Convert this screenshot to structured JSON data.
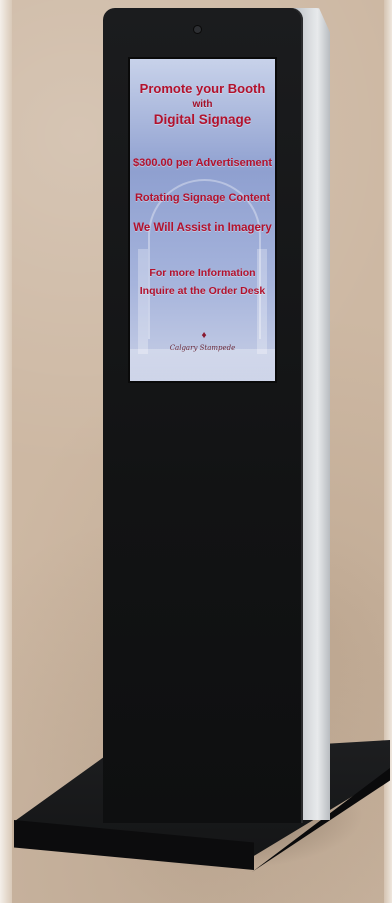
{
  "kiosk": {
    "screen": {
      "headline_line1": "Promote your Booth",
      "headline_line2": "with",
      "headline_line3": "Digital Signage",
      "price_line": "$300.00 per Advertisement",
      "feature_line1": "Rotating Signage Content",
      "feature_line2": "We Will Assist in Imagery",
      "info_line1": "For more Information",
      "info_line2": "Inquire at the Order Desk",
      "logo_text": "Calgary Stampede"
    }
  },
  "colors": {
    "screen_text": "#b3122d",
    "kiosk_body": "#121314",
    "kiosk_side": "#c9cdd1",
    "background": "#cdb8a3"
  }
}
